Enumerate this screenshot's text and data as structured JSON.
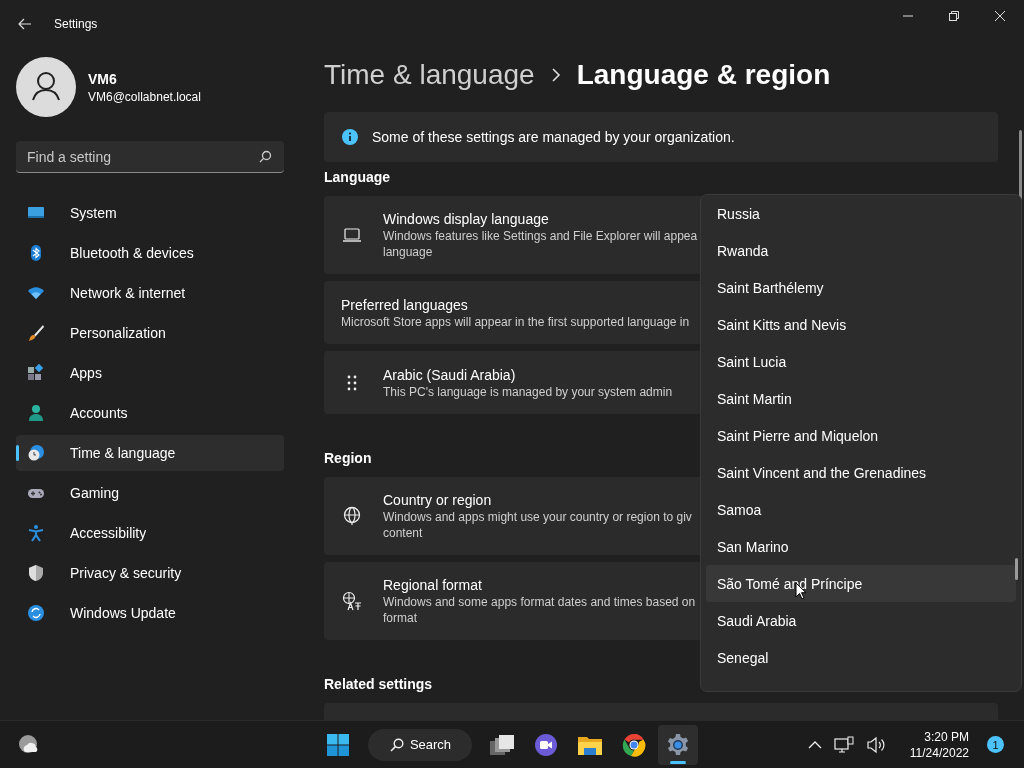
{
  "window": {
    "title": "Settings"
  },
  "user": {
    "name": "VM6",
    "email": "VM6@collabnet.local"
  },
  "search": {
    "placeholder": "Find a setting"
  },
  "nav": [
    {
      "label": "System",
      "selected": false
    },
    {
      "label": "Bluetooth & devices",
      "selected": false
    },
    {
      "label": "Network & internet",
      "selected": false
    },
    {
      "label": "Personalization",
      "selected": false
    },
    {
      "label": "Apps",
      "selected": false
    },
    {
      "label": "Accounts",
      "selected": false
    },
    {
      "label": "Time & language",
      "selected": true
    },
    {
      "label": "Gaming",
      "selected": false
    },
    {
      "label": "Accessibility",
      "selected": false
    },
    {
      "label": "Privacy & security",
      "selected": false
    },
    {
      "label": "Windows Update",
      "selected": false
    }
  ],
  "breadcrumb": {
    "parent": "Time & language",
    "current": "Language & region"
  },
  "notice": "Some of these settings are managed by your organization.",
  "sections": [
    {
      "heading": "Language",
      "cards": [
        {
          "title": "Windows display language",
          "lines": [
            "Windows features like Settings and File Explorer will appea",
            "language"
          ]
        },
        {
          "title": "Preferred languages",
          "lines": [
            "Microsoft Store apps will appear in the first supported language in"
          ]
        },
        {
          "title": "Arabic (Saudi Arabia)",
          "lines": [
            "This PC's language is managed by your system admin"
          ]
        }
      ]
    },
    {
      "heading": "Region",
      "cards": [
        {
          "title": "Country or region",
          "lines": [
            "Windows and apps might use your country or region to giv",
            "content"
          ]
        },
        {
          "title": "Regional format",
          "lines": [
            "Windows and some apps format dates and times based on",
            "format"
          ]
        }
      ]
    }
  ],
  "related": {
    "heading": "Related settings"
  },
  "country_list": {
    "items": [
      {
        "label": "Russia",
        "selected": false
      },
      {
        "label": "Rwanda",
        "selected": false
      },
      {
        "label": "Saint Barthélemy",
        "selected": false
      },
      {
        "label": "Saint Kitts and Nevis",
        "selected": false
      },
      {
        "label": "Saint Lucia",
        "selected": false
      },
      {
        "label": "Saint Martin",
        "selected": false
      },
      {
        "label": "Saint Pierre and Miquelon",
        "selected": false
      },
      {
        "label": "Saint Vincent and the Grenadines",
        "selected": false
      },
      {
        "label": "Samoa",
        "selected": false
      },
      {
        "label": "San Marino",
        "selected": false
      },
      {
        "label": "São Tomé and Príncipe",
        "selected": true
      },
      {
        "label": "Saudi Arabia",
        "selected": false
      },
      {
        "label": "Senegal",
        "selected": false
      }
    ]
  },
  "taskbar": {
    "search_label": "Search",
    "apps": [
      {
        "selected": false
      },
      {
        "selected": false
      },
      {
        "selected": false
      },
      {
        "selected": false
      },
      {
        "selected": true
      }
    ],
    "time": "3:20 PM",
    "date": "11/24/2022",
    "notification_count": "1"
  }
}
